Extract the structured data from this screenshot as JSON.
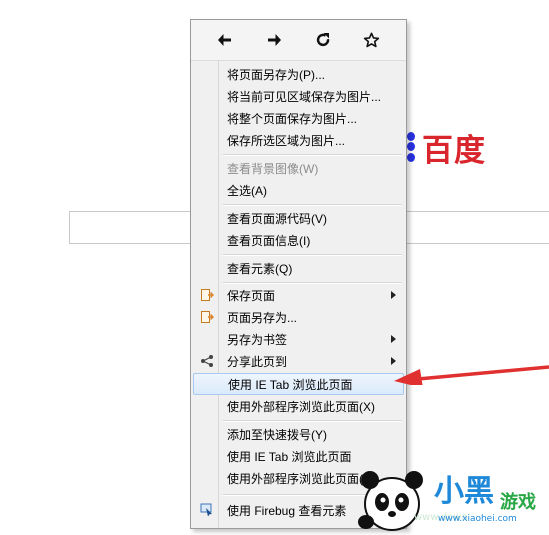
{
  "background": {
    "logo_text": "百度",
    "search_value": ""
  },
  "menu": {
    "nav": [
      {
        "name": "back-icon",
        "glyph": "arrow-left"
      },
      {
        "name": "forward-icon",
        "glyph": "arrow-right"
      },
      {
        "name": "reload-icon",
        "glyph": "reload"
      },
      {
        "name": "bookmark-star-icon",
        "glyph": "star"
      }
    ],
    "items": [
      {
        "label": "将页面另存为(P)..."
      },
      {
        "label": "将当前可见区域保存为图片..."
      },
      {
        "label": "将整个页面保存为图片..."
      },
      {
        "label": "保存所选区域为图片..."
      },
      {
        "label": "查看背景图像(W)",
        "disabled": true
      },
      {
        "label": "全选(A)"
      },
      {
        "label": "查看页面源代码(V)"
      },
      {
        "label": "查看页面信息(I)"
      },
      {
        "label": "查看元素(Q)"
      },
      {
        "label": "保存页面",
        "icon": "save-page-icon",
        "submenu": true
      },
      {
        "label": "页面另存为...",
        "icon": "save-as-icon"
      },
      {
        "label": "另存为书签",
        "submenu": true
      },
      {
        "label": "分享此页到",
        "icon": "share-icon",
        "submenu": true
      },
      {
        "label": "使用 IE Tab 浏览此页面",
        "highlighted": true
      },
      {
        "label": "使用外部程序浏览此页面(X)"
      },
      {
        "label": "添加至快速拨号(Y)"
      },
      {
        "label": "使用 IE Tab 浏览此页面"
      },
      {
        "label": "使用外部程序浏览此页面(X)"
      },
      {
        "label": "使用 Firebug 查看元素",
        "icon": "firebug-icon"
      }
    ]
  },
  "annotation": {
    "color": "#e03030"
  },
  "watermark": {
    "brand_main": "小黑",
    "brand_sub": "游戏",
    "url": "www.xiaohei.com",
    "faint": "www.down"
  },
  "colors": {
    "highlight": "#dbeafa",
    "baidu_red": "#d8262c",
    "baidu_blue": "#2932e1"
  }
}
